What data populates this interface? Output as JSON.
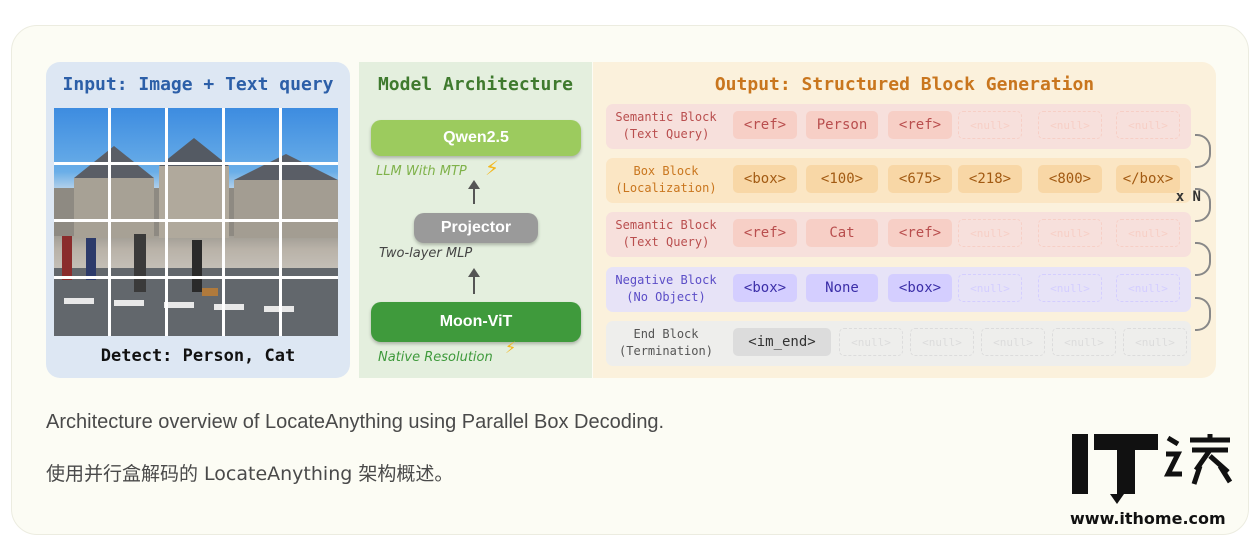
{
  "figure": {
    "input": {
      "title": "Input: Image + Text query",
      "caption": "Detect: Person, Cat"
    },
    "model": {
      "title": "Model Architecture",
      "llm": "Qwen2.5",
      "llm_note": "LLM With MTP",
      "projector": "Projector",
      "projector_note": "Two-layer MLP",
      "encoder": "Moon-ViT",
      "encoder_note": "Native Resolution"
    },
    "output": {
      "title": "Output: Structured Block Generation",
      "repeat_label": "x N",
      "rows": [
        {
          "label1": "Semantic Block",
          "label2": "(Text Query)",
          "color": "#b94e4e",
          "bg": "#f7e0dc",
          "tokbg": "#f7cfc6",
          "tokfg": "#b94e4e",
          "tokens": [
            "<ref>",
            "Person",
            "<ref>",
            "<null>",
            "<null>",
            "<null>"
          ]
        },
        {
          "label1": "Box Block",
          "label2": "(Localization)",
          "color": "#c9761e",
          "bg": "#fbe6c4",
          "tokbg": "#f8d7a6",
          "tokfg": "#a25a12",
          "tokens": [
            "<box>",
            "<100>",
            "<675>",
            "<218>",
            "<800>",
            "</box>"
          ]
        },
        {
          "label1": "Semantic Block",
          "label2": "(Text Query)",
          "color": "#b94e4e",
          "bg": "#f7e0dc",
          "tokbg": "#f7cfc6",
          "tokfg": "#b94e4e",
          "tokens": [
            "<ref>",
            "Cat",
            "<ref>",
            "<null>",
            "<null>",
            "<null>"
          ]
        },
        {
          "label1": "Negative Block",
          "label2": "(No Object)",
          "color": "#5b4dc7",
          "bg": "#e7e3f7",
          "tokbg": "#d4ceff",
          "tokfg": "#3b2ea8",
          "tokens": [
            "<box>",
            "None",
            "<box>",
            "<null>",
            "<null>",
            "<null>"
          ]
        },
        {
          "label1": "End Block",
          "label2": "(Termination)",
          "color": "#555555",
          "bg": "#eeeeec",
          "tokbg": "#dcdcdc",
          "tokfg": "#333333",
          "tokens": [
            "<im_end>",
            "<null>",
            "<null>",
            "<null>",
            "<null>",
            "<null>"
          ]
        }
      ]
    }
  },
  "caption_en": "Architecture overview of LocateAnything using Parallel Box Decoding.",
  "caption_zh": "使用并行盒解码的 LocateAnything 架构概述。",
  "logo": {
    "text": "IT之家",
    "url": "www.ithome.com"
  }
}
